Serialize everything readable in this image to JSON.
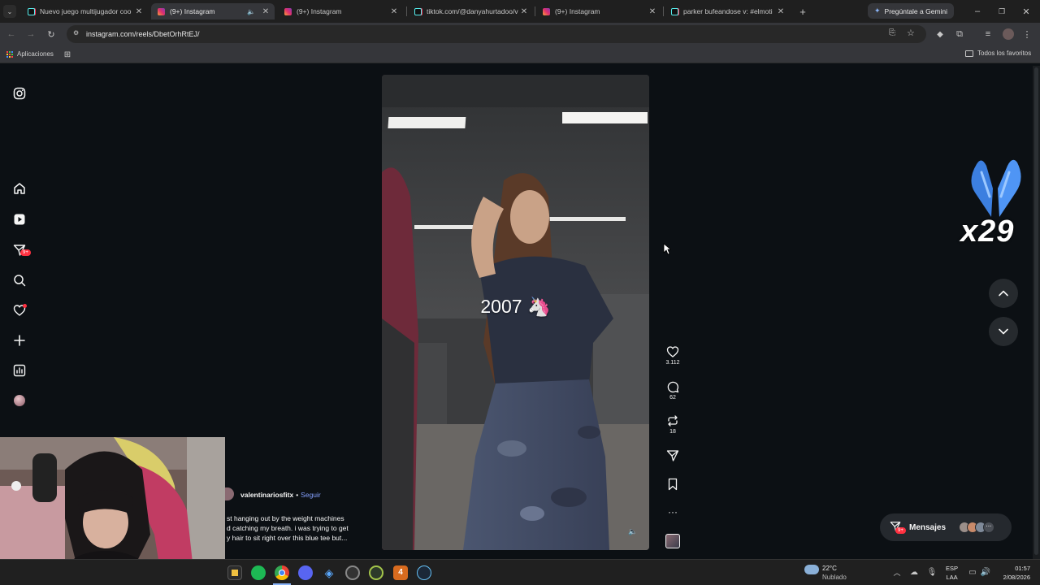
{
  "browser": {
    "tabs": [
      {
        "title": "Nuevo juego multijugador coo",
        "favicon": "tiktok-icon",
        "active": false
      },
      {
        "title": "(9+) Instagram",
        "favicon": "instagram-icon",
        "active": true
      },
      {
        "title": "(9+) Instagram",
        "favicon": "instagram-icon",
        "active": false
      },
      {
        "title": "tiktok.com/@danyahurtadoo/v",
        "favicon": "tiktok-icon",
        "active": false
      },
      {
        "title": "(9+) Instagram",
        "favicon": "instagram-icon",
        "active": false
      },
      {
        "title": "parker bufeandose v: #elmoti",
        "favicon": "tiktok-icon",
        "active": false
      }
    ],
    "gemini_label": "Pregúntale a Gemini",
    "url": "instagram.com/reels/DbetOrhRtEJ/",
    "bookmarks": {
      "apps_label": "Aplicaciones",
      "all_favorites_label": "Todos los favoritos"
    }
  },
  "instagram": {
    "notification_badge": "9+",
    "reel": {
      "overlay_text": "2007 🦄",
      "username": "valentinariosfitx",
      "follow_label": "Seguir",
      "caption_lines": [
        "st hanging out by the weight machines",
        "d catching my breath. i was trying to get",
        "y hair to sit right over this blue tee but..."
      ],
      "likes": "3.112",
      "comments": "62",
      "reposts": "18"
    },
    "messages_label": "Mensajes",
    "messages_badge": "9+",
    "overlay_sticker_text": "x29"
  },
  "taskbar": {
    "weather_temp": "22°C",
    "weather_desc": "Nublado",
    "lang_top": "ESP",
    "lang_bottom": "LAA",
    "time": "01:57",
    "date": "2/08/2026"
  },
  "colors": {
    "accent_red": "#ff3040",
    "follow_blue": "#85a1ff",
    "ig_bg": "#0c1014"
  }
}
